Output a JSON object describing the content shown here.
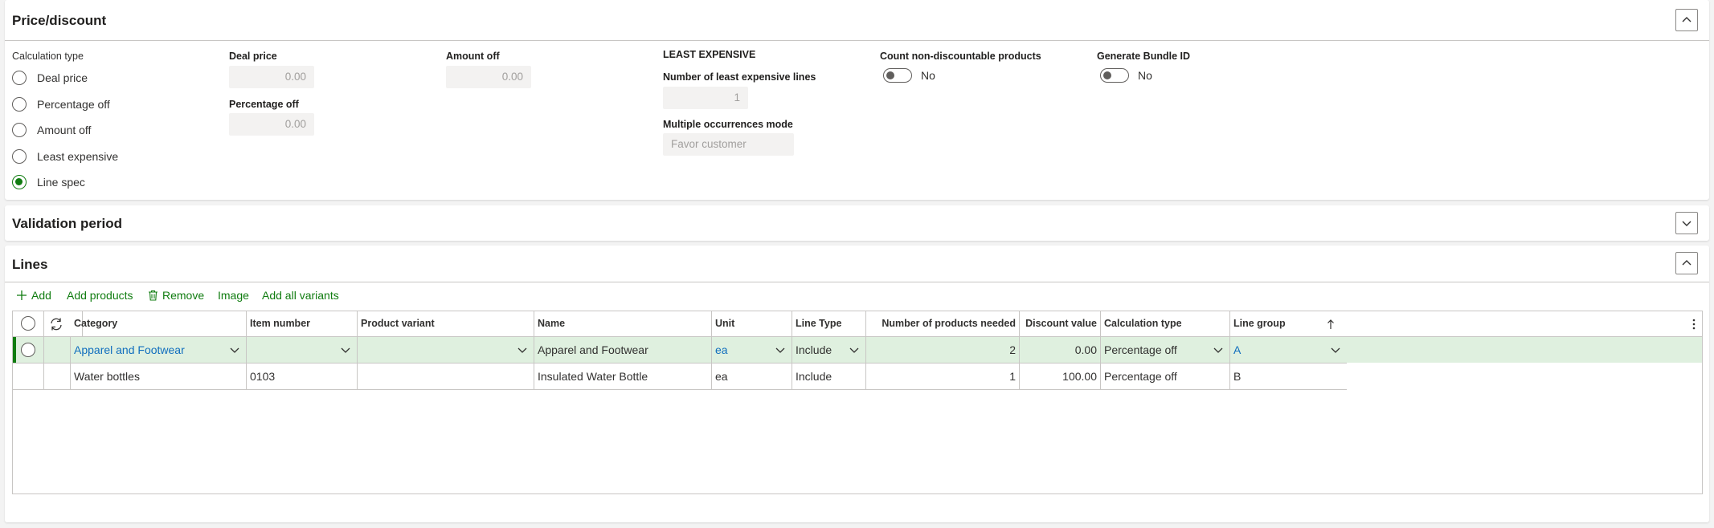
{
  "price_discount": {
    "title": "Price/discount",
    "calculation_type_label": "Calculation type",
    "options": [
      {
        "label": "Deal price",
        "selected": false
      },
      {
        "label": "Percentage off",
        "selected": false
      },
      {
        "label": "Amount off",
        "selected": false
      },
      {
        "label": "Least expensive",
        "selected": false
      },
      {
        "label": "Line spec",
        "selected": true
      }
    ],
    "deal_price": {
      "label": "Deal price",
      "value": "0.00"
    },
    "percentage_off": {
      "label": "Percentage off",
      "value": "0.00"
    },
    "amount_off": {
      "label": "Amount off",
      "value": "0.00"
    },
    "least_expensive": {
      "heading": "LEAST EXPENSIVE",
      "lines_label": "Number of least expensive lines",
      "lines_value": "1",
      "mode_label": "Multiple occurrences mode",
      "mode_value": "Favor customer"
    },
    "count_non_discountable": {
      "label": "Count non-discountable products",
      "value": "No"
    },
    "generate_bundle_id": {
      "label": "Generate Bundle ID",
      "value": "No"
    }
  },
  "validation_period": {
    "title": "Validation period"
  },
  "lines": {
    "title": "Lines",
    "toolbar": {
      "add": "Add",
      "add_products": "Add products",
      "remove": "Remove",
      "image": "Image",
      "add_all_variants": "Add all variants"
    },
    "columns": [
      "Category",
      "Item number",
      "Product variant",
      "Name",
      "Unit",
      "Line Type",
      "Number of products needed",
      "Discount value",
      "Calculation type",
      "Line group"
    ],
    "sort_icon": "arrow-up-icon",
    "rows": [
      {
        "category": "Apparel and Footwear",
        "item_number": "",
        "product_variant": "",
        "name": "Apparel and Footwear",
        "unit": "ea",
        "line_type": "Include",
        "products_needed": "2",
        "discount_value": "0.00",
        "calculation_type": "Percentage off",
        "line_group": "A",
        "selected": true
      },
      {
        "category": "Water bottles",
        "item_number": "0103",
        "product_variant": "",
        "name": "Insulated Water Bottle",
        "unit": "ea",
        "line_type": "Include",
        "products_needed": "1",
        "discount_value": "100.00",
        "calculation_type": "Percentage off",
        "line_group": "B",
        "selected": false
      }
    ]
  },
  "colors": {
    "accent": "#107c10",
    "link": "#106ebe",
    "selected_row": "#dff0df"
  }
}
